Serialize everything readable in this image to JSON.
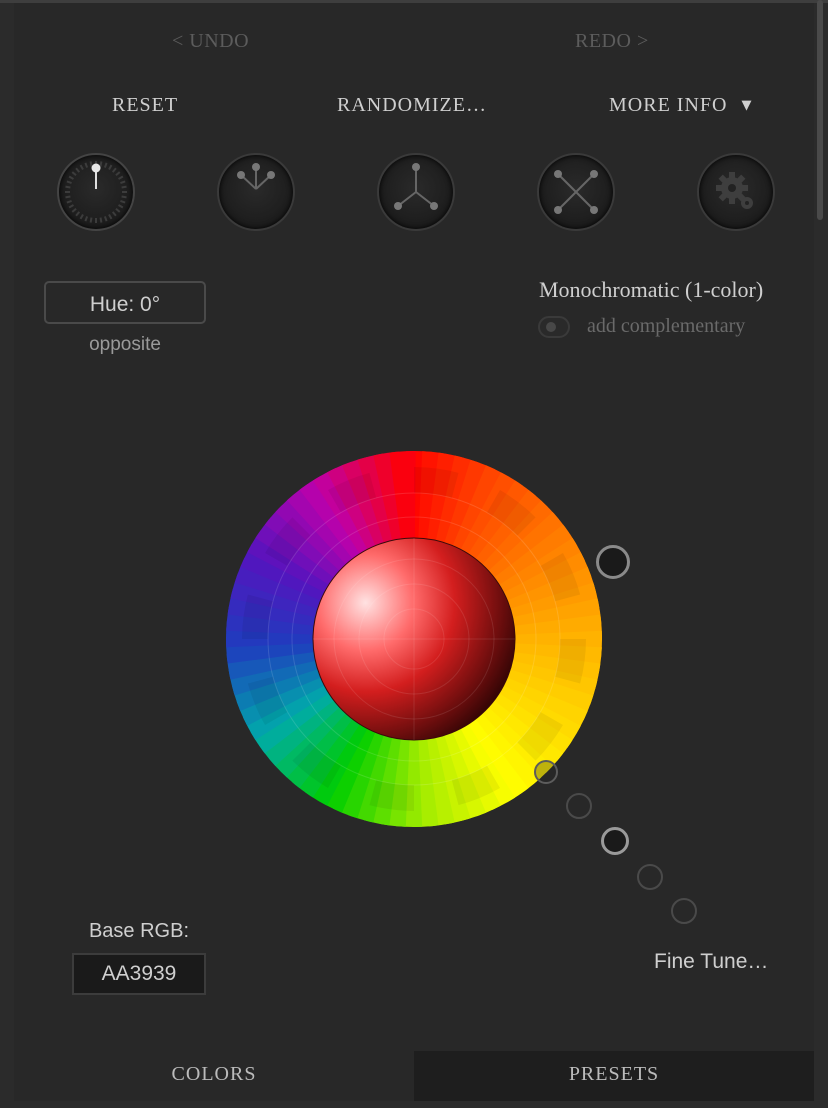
{
  "history": {
    "undo": "< UNDO",
    "redo": "REDO >"
  },
  "menu": {
    "reset": "RESET",
    "randomize": "RANDOMIZE…",
    "more_info": "MORE INFO",
    "more_info_arrow": "▼"
  },
  "scheme_knobs": [
    {
      "icon": "mono-knob-icon",
      "selected": true
    },
    {
      "icon": "complementary-knob-icon",
      "selected": false
    },
    {
      "icon": "triad-knob-icon",
      "selected": false
    },
    {
      "icon": "tetrad-knob-icon",
      "selected": false
    },
    {
      "icon": "gear-knob-icon",
      "selected": false
    }
  ],
  "hue": {
    "label": "Hue: 0°",
    "sub": "opposite"
  },
  "scheme": {
    "name": "Monochromatic (1-color)",
    "toggle_label": "add complementary",
    "toggle_on": false
  },
  "base": {
    "label": "Base RGB:",
    "value": "AA3939"
  },
  "fine_tune": "Fine Tune…",
  "tabs": {
    "colors": "COLORS",
    "presets": "PRESETS",
    "active": "COLORS"
  },
  "colors": {
    "background": "#282828",
    "base": "#AA3939",
    "text": "#cfcfcf"
  }
}
